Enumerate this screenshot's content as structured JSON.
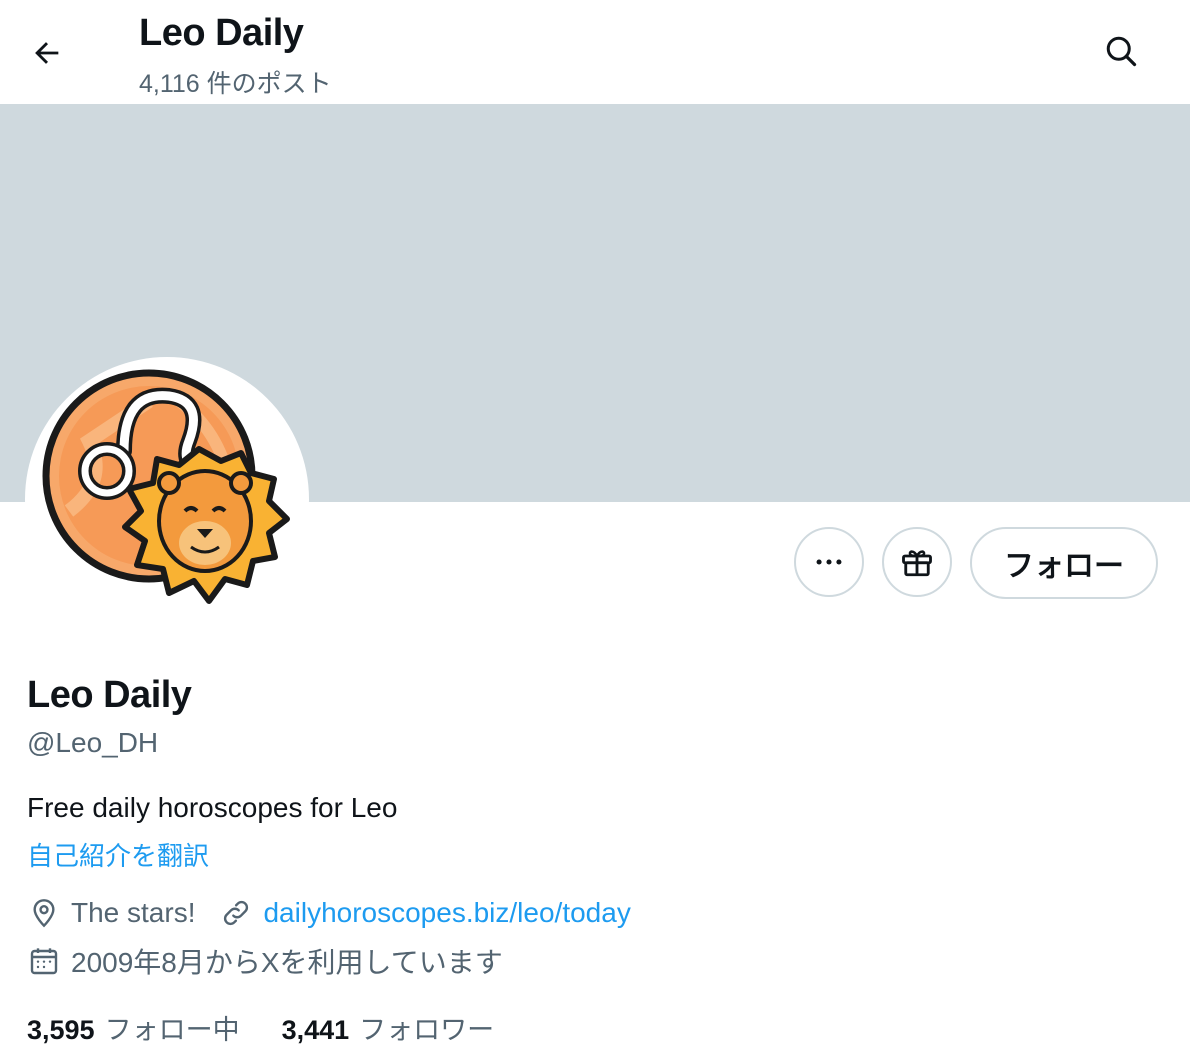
{
  "header": {
    "title": "Leo Daily",
    "post_count": "4,116 件のポスト"
  },
  "profile": {
    "display_name": "Leo Daily",
    "handle": "@Leo_DH",
    "bio": "Free daily horoscopes for Leo",
    "translate_label": "自己紹介を翻訳",
    "location": "The stars!",
    "website": "dailyhoroscopes.biz/leo/today",
    "joined": "2009年8月からXを利用しています",
    "following_count": "3,595",
    "following_label": "フォロー中",
    "followers_count": "3,441",
    "followers_label": "フォロワー"
  },
  "actions": {
    "follow_label": "フォロー"
  },
  "icons": {
    "back": "arrow-left-icon",
    "search": "search-icon",
    "more": "more-icon",
    "gift": "gift-icon",
    "location": "location-pin-icon",
    "link": "link-icon",
    "calendar": "calendar-icon"
  },
  "colors": {
    "banner": "#cfd9de",
    "accent": "#1d9bf0",
    "secondary_text": "#536471",
    "primary_text": "#0f1419"
  }
}
